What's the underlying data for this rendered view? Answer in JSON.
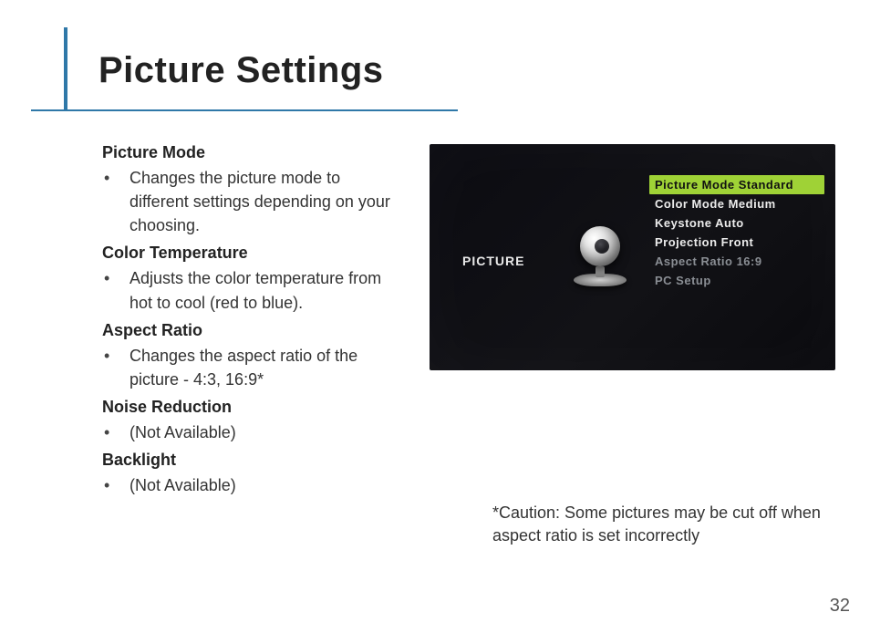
{
  "title": "Picture Settings",
  "page_number": "32",
  "sections": [
    {
      "heading": "Picture Mode",
      "bullet": "Changes the picture mode to different settings depending on your choosing."
    },
    {
      "heading": "Color Temperature",
      "bullet": "Adjusts the color temperature from hot to cool (red to blue)."
    },
    {
      "heading": "Aspect Ratio",
      "bullet": "Changes the aspect ratio of the picture - 4:3, 16:9*"
    },
    {
      "heading": "Noise Reduction",
      "bullet": "(Not Available)"
    },
    {
      "heading": "Backlight",
      "bullet": "(Not Available)"
    }
  ],
  "caption": "*Caution: Some pictures may be cut off when aspect ratio is set incorrectly",
  "osd": {
    "section_label": "PICTURE",
    "menu_items": [
      {
        "text": "Picture Mode Standard",
        "selected": true,
        "dim": false
      },
      {
        "text": "Color Mode Medium",
        "selected": false,
        "dim": false
      },
      {
        "text": "Keystone Auto",
        "selected": false,
        "dim": false
      },
      {
        "text": "Projection Front",
        "selected": false,
        "dim": false
      },
      {
        "text": "Aspect Ratio 16:9",
        "selected": false,
        "dim": true
      },
      {
        "text": "PC Setup",
        "selected": false,
        "dim": true
      }
    ]
  }
}
